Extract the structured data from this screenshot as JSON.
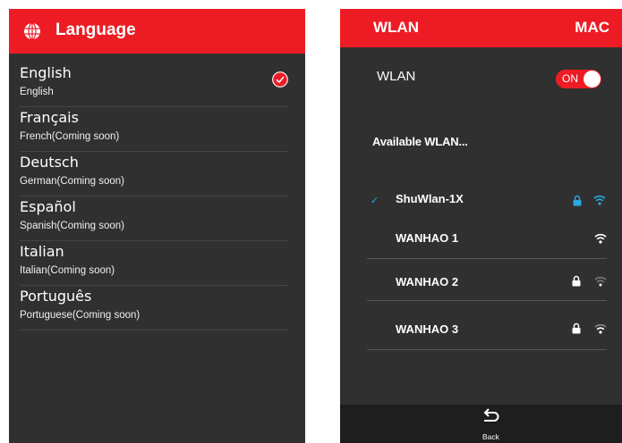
{
  "language_panel": {
    "title": "Language",
    "items": [
      {
        "name": "English",
        "sub": "English",
        "selected": true
      },
      {
        "name": "Français",
        "sub": "French(Coming soon)",
        "selected": false
      },
      {
        "name": "Deutsch",
        "sub": "German(Coming soon)",
        "selected": false
      },
      {
        "name": "Español",
        "sub": "Spanish(Coming soon)",
        "selected": false
      },
      {
        "name": "Italian",
        "sub": "Italian(Coming soon)",
        "selected": false
      },
      {
        "name": "Português",
        "sub": "Portuguese(Coming soon)",
        "selected": false
      }
    ]
  },
  "wlan_panel": {
    "title": "WLAN",
    "mac_label": "MAC",
    "wlan_label": "WLAN",
    "toggle_text": "ON",
    "available_label": "Available WLAN...",
    "networks": [
      {
        "ssid": "ShuWlan-1X",
        "connected": true,
        "locked": true
      },
      {
        "ssid": "WANHAO 1",
        "connected": false,
        "locked": false
      },
      {
        "ssid": "WANHAO 2",
        "connected": false,
        "locked": true
      },
      {
        "ssid": "WANHAO 3",
        "connected": false,
        "locked": true
      }
    ],
    "back_label": "Back"
  },
  "colors": {
    "accent": "#ed1c24",
    "panel_bg": "#303030",
    "connected": "#29a9e0",
    "bottom_bar": "#1e1e1e"
  },
  "icons": [
    "globe-icon",
    "check-icon",
    "check-mark-icon",
    "lock-icon",
    "wifi-icon",
    "back-arrow-icon"
  ]
}
